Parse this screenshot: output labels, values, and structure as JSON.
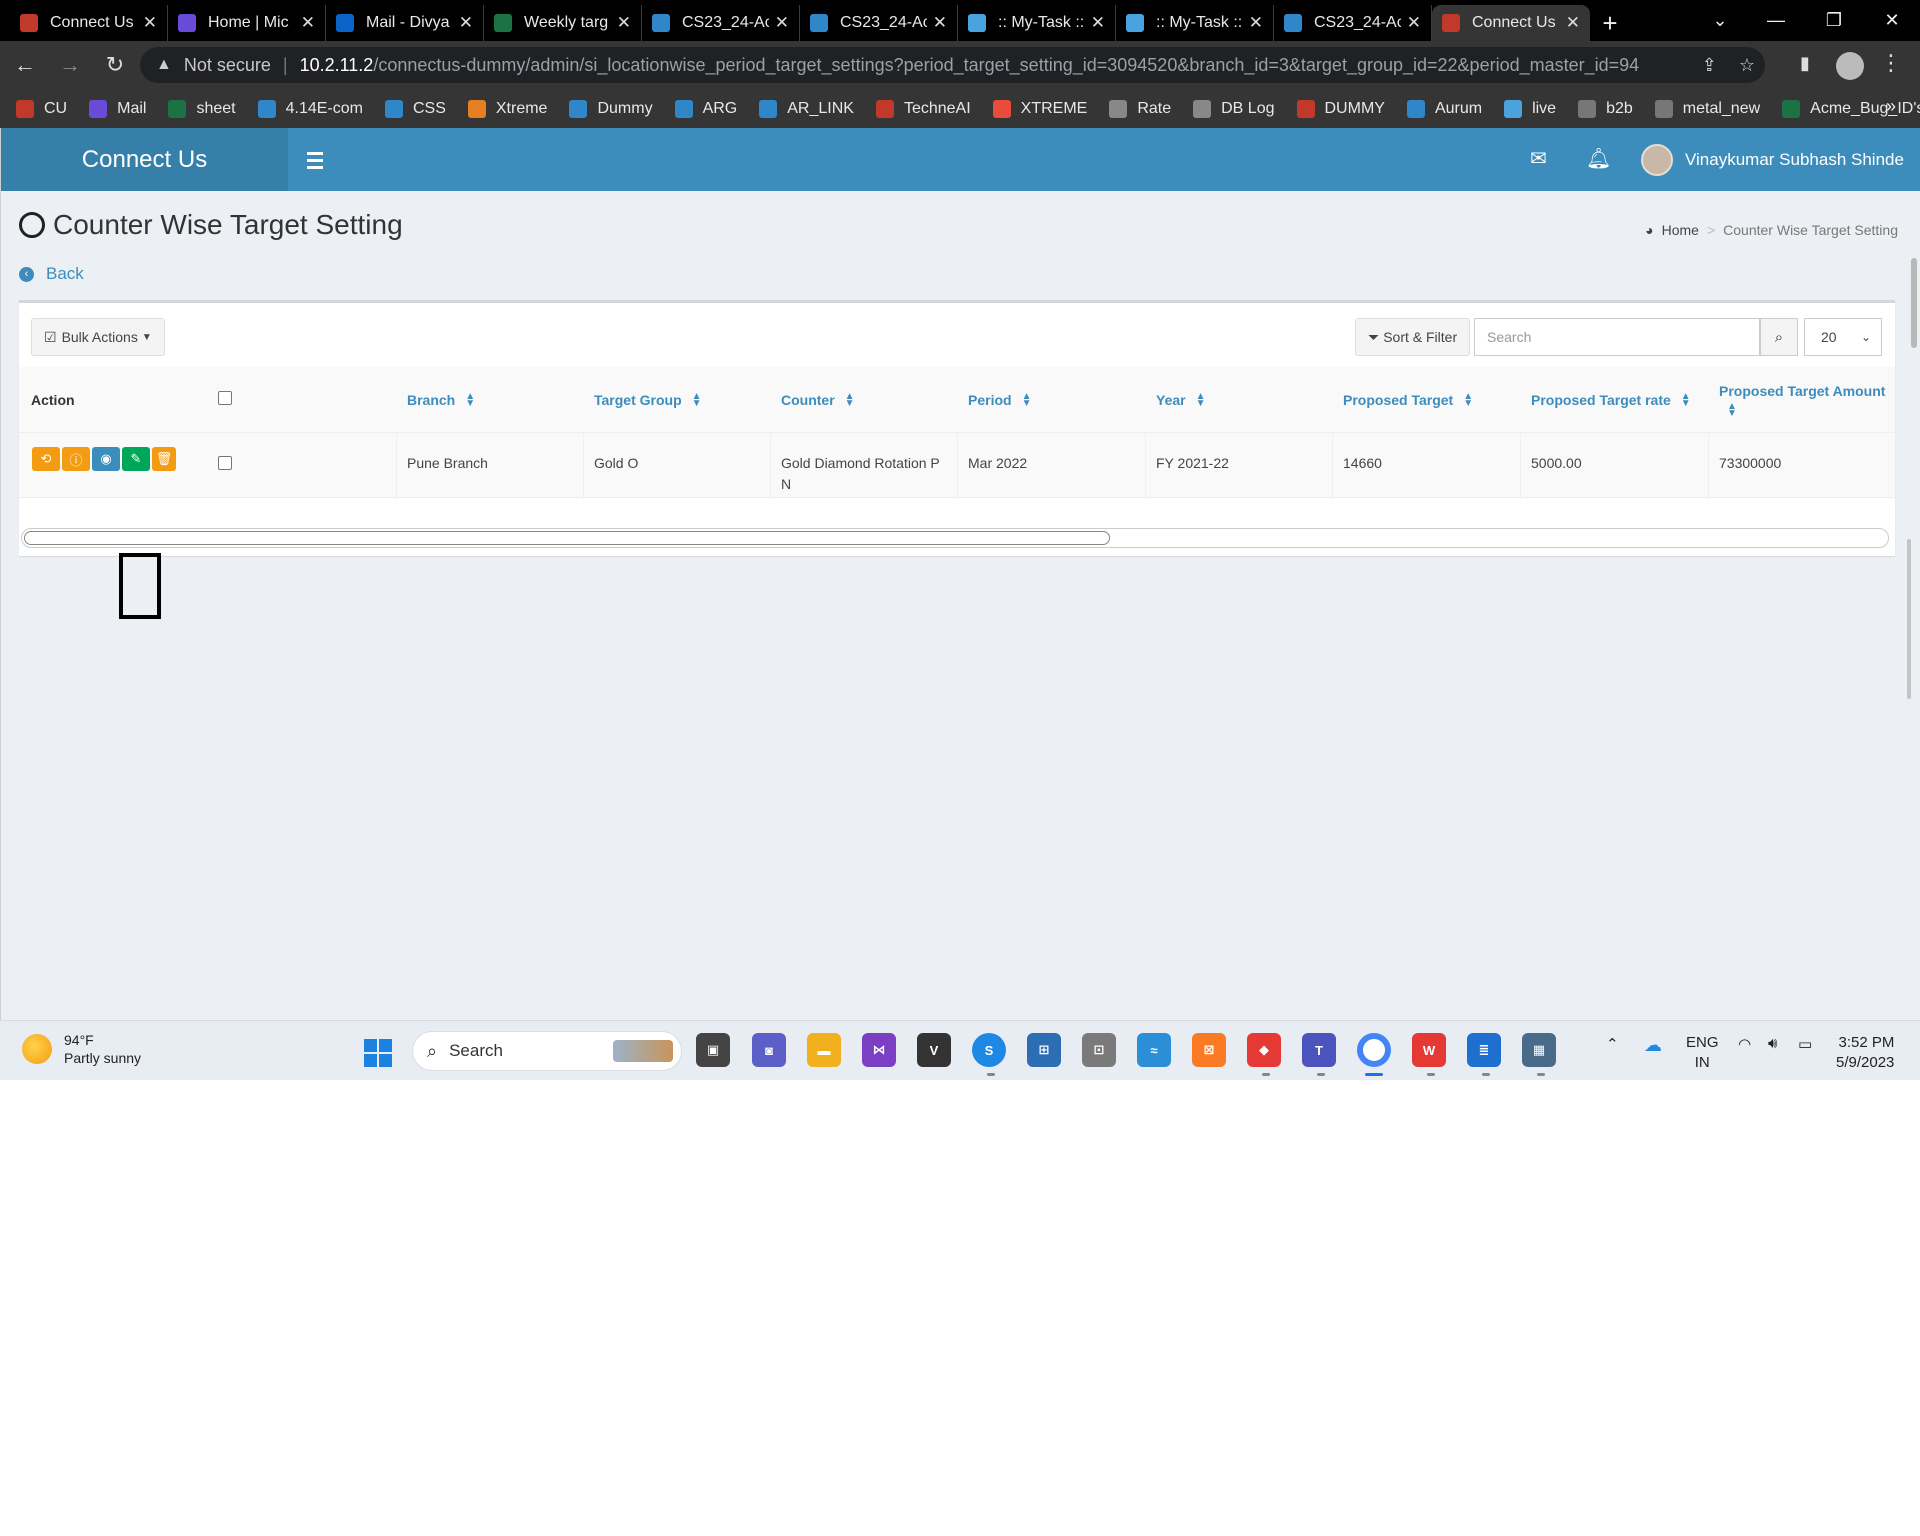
{
  "browser": {
    "tabs": [
      {
        "title": "Connect Us",
        "icon": "connect-us-icon",
        "color": "#c0392b",
        "active": false
      },
      {
        "title": "Home | Mic",
        "icon": "copilot-icon",
        "color": "#6a4bd8",
        "active": false
      },
      {
        "title": "Mail - Divya",
        "icon": "outlook-icon",
        "color": "#0a64c8",
        "active": false
      },
      {
        "title": "Weekly targ",
        "icon": "excel-icon",
        "color": "#1d7245",
        "active": false
      },
      {
        "title": "CS23_24-Ac",
        "icon": "jira-like-icon",
        "color": "#2f86c9",
        "active": false
      },
      {
        "title": "CS23_24-Ac",
        "icon": "jira-like-icon",
        "color": "#2f86c9",
        "active": false
      },
      {
        "title": ":: My-Task ::",
        "icon": "react-icon",
        "color": "#4aa3df",
        "active": false
      },
      {
        "title": ":: My-Task ::",
        "icon": "react-icon",
        "color": "#4aa3df",
        "active": false
      },
      {
        "title": "CS23_24-Ac",
        "icon": "jira-like-icon",
        "color": "#2f86c9",
        "active": false
      },
      {
        "title": "Connect Us",
        "icon": "connect-us-icon",
        "color": "#c0392b",
        "active": true
      }
    ],
    "address": {
      "security": "Not secure",
      "host": "10.2.11.2",
      "path": "/connectus-dummy/admin/si_locationwise_period_target_settings?period_target_setting_id=3094520&branch_id=3&target_group_id=22&period_master_id=94"
    },
    "bookmarks": [
      {
        "label": "CU",
        "color": "#c0392b"
      },
      {
        "label": "Mail",
        "color": "#6a4bd8"
      },
      {
        "label": "sheet",
        "color": "#1d7245"
      },
      {
        "label": "4.14E-com",
        "color": "#2f86c9"
      },
      {
        "label": "CSS",
        "color": "#2f86c9"
      },
      {
        "label": "Xtreme",
        "color": "#e67e22"
      },
      {
        "label": "Dummy",
        "color": "#2f86c9"
      },
      {
        "label": "ARG",
        "color": "#2f86c9"
      },
      {
        "label": "AR_LINK",
        "color": "#2f86c9"
      },
      {
        "label": "TechneAI",
        "color": "#c0392b"
      },
      {
        "label": "XTREME",
        "color": "#e74c3c"
      },
      {
        "label": "Rate",
        "color": "#888888"
      },
      {
        "label": "DB Log",
        "color": "#888888"
      },
      {
        "label": "DUMMY",
        "color": "#c0392b"
      },
      {
        "label": "Aurum",
        "color": "#2f86c9"
      },
      {
        "label": "live",
        "color": "#4aa3df"
      },
      {
        "label": "b2b",
        "color": "#777777"
      },
      {
        "label": "metal_new",
        "color": "#777777"
      },
      {
        "label": "Acme_Bug_ID's",
        "color": "#1d7245"
      }
    ],
    "bookmarks_more": "»"
  },
  "app": {
    "brand": "Connect Us",
    "user_name": "Vinaykumar Subhash Shinde",
    "page_title": "Counter Wise Target Setting",
    "breadcrumb": {
      "home": "Home",
      "current": "Counter Wise Target Setting"
    },
    "back_label": "Back",
    "toolbar": {
      "bulk_actions": "Bulk Actions",
      "sort_filter": "Sort & Filter",
      "search_placeholder": "Search",
      "page_size": "20"
    },
    "table": {
      "headers": {
        "action": "Action",
        "branch": "Branch",
        "target_group": "Target Group",
        "counter": "Counter",
        "period": "Period",
        "year": "Year",
        "proposed_target": "Proposed Target",
        "proposed_target_rate": "Proposed Target rate",
        "proposed_target_amount": "Proposed Target Amount"
      },
      "rows": [
        {
          "branch": "Pune Branch",
          "target_group": "Gold O",
          "counter_line1": "Gold Diamond Rotation P",
          "counter_line2": "N",
          "period": "Mar 2022",
          "year": "FY 2021-22",
          "proposed_target": "14660",
          "proposed_target_rate": "5000.00",
          "proposed_target_amount": "73300000"
        }
      ],
      "action_buttons": [
        {
          "icon": "history-icon",
          "color": "#f39c12"
        },
        {
          "icon": "info-icon",
          "color": "#f39c12"
        },
        {
          "icon": "eye-icon",
          "color": "#3c8dbc"
        },
        {
          "icon": "edit-icon",
          "color": "#00a65a"
        },
        {
          "icon": "trash-icon",
          "color": "#f39c12"
        }
      ]
    }
  },
  "taskbar": {
    "weather_temp": "94°F",
    "weather_desc": "Partly sunny",
    "search_label": "Search",
    "lang_line1": "ENG",
    "lang_line2": "IN",
    "time": "3:52 PM",
    "date": "5/9/2023"
  }
}
